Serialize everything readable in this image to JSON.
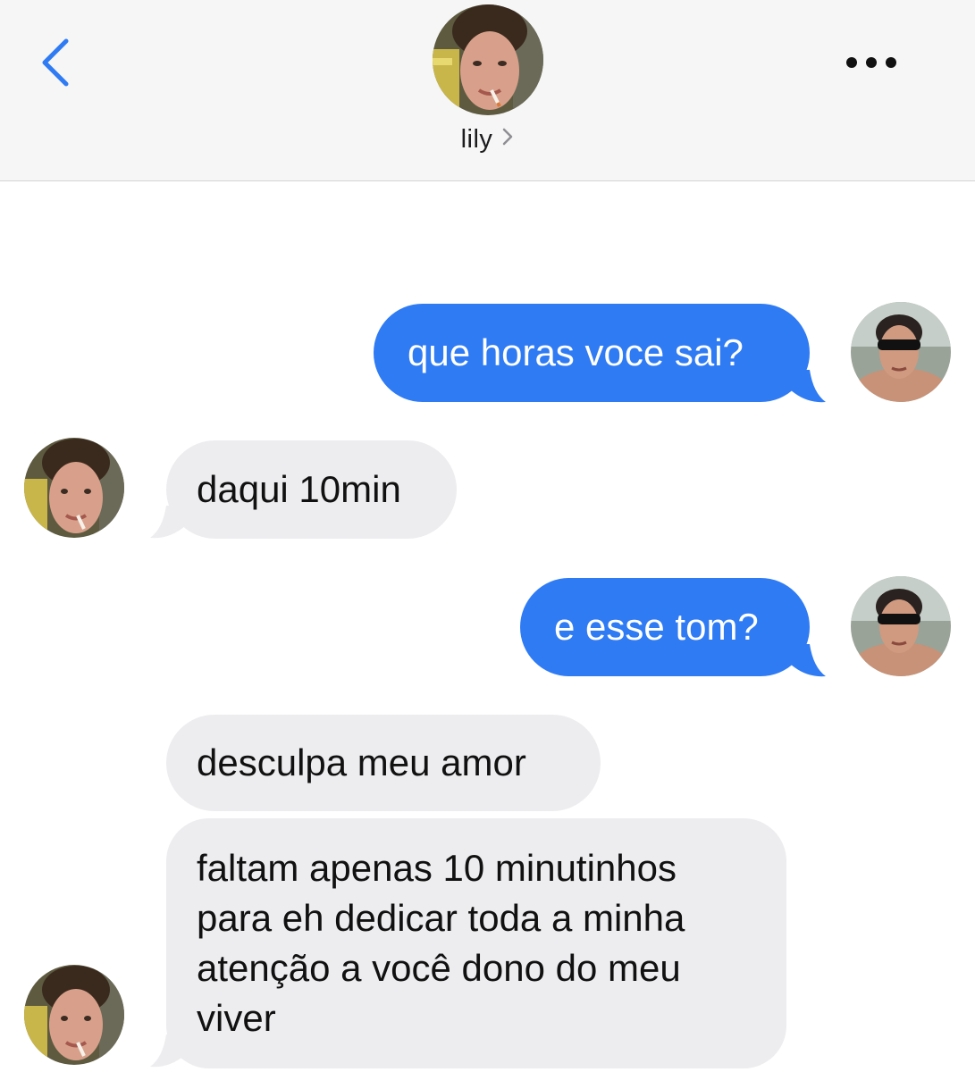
{
  "header": {
    "contact_name": "lily",
    "back_icon": "chevron-left-icon",
    "more_icon": "ellipsis-icon"
  },
  "colors": {
    "outgoing_bubble": "#2f7bf4",
    "incoming_bubble": "#ededf0",
    "accent": "#2f7bf4",
    "header_bg": "#f6f6f6"
  },
  "messages": [
    {
      "direction": "outgoing",
      "text": "que horas voce sai?"
    },
    {
      "direction": "incoming",
      "text": "daqui 10min"
    },
    {
      "direction": "outgoing",
      "text": "e esse tom?"
    },
    {
      "direction": "incoming",
      "text": "desculpa meu amor"
    },
    {
      "direction": "incoming",
      "text": "faltam apenas 10 minutinhos\npara eh dedicar toda a minha\natenção a você dono do meu\nviver"
    }
  ]
}
